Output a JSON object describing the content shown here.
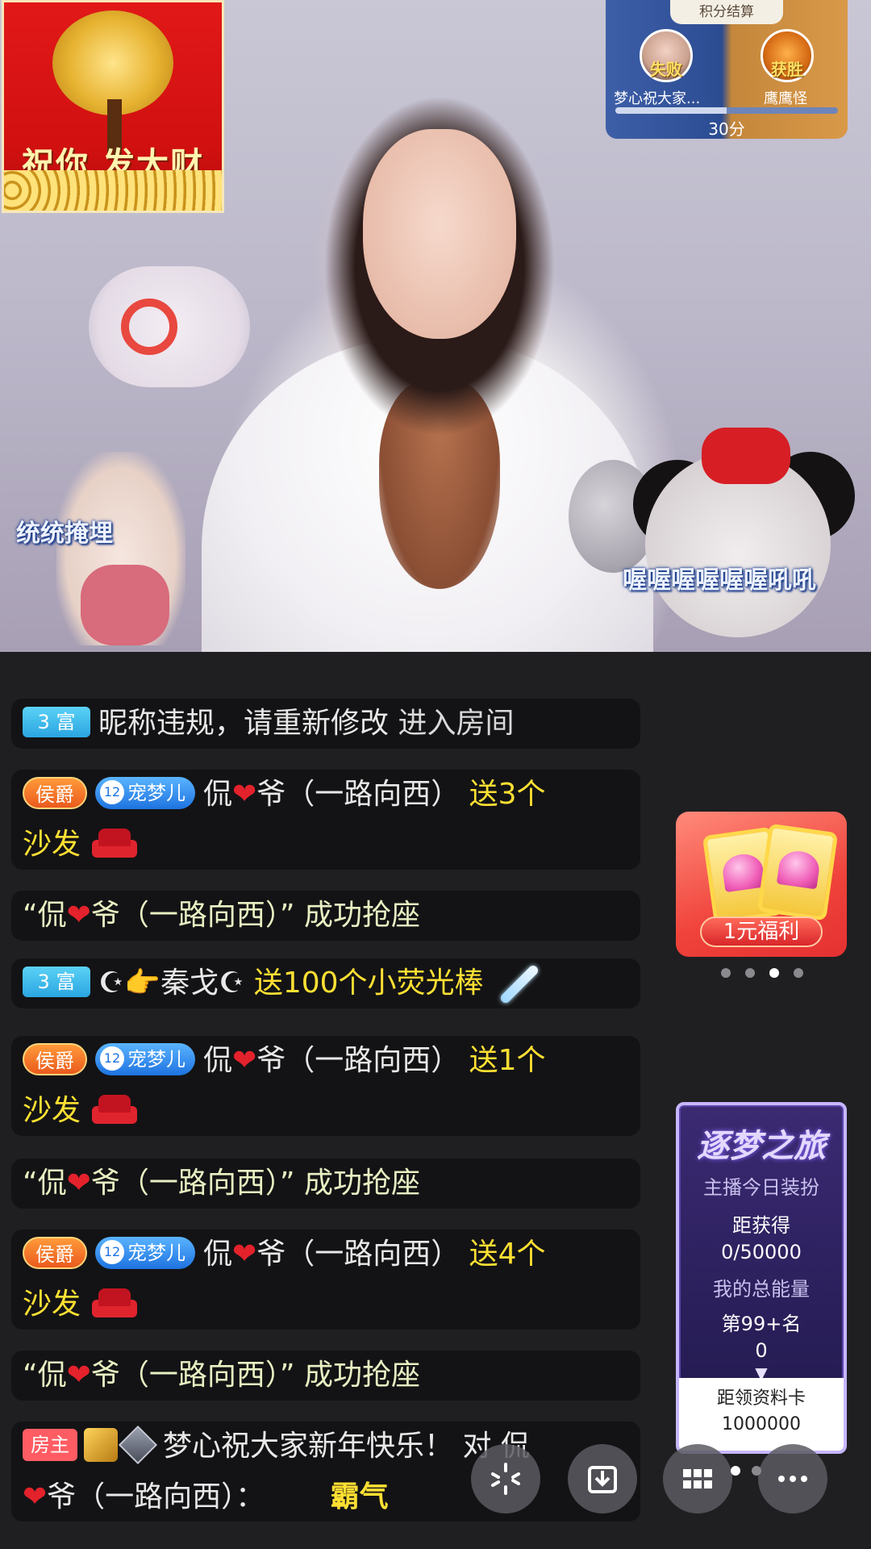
{
  "video": {
    "fortune_sticker": {
      "text": "祝你 发大财"
    },
    "pk_panel": {
      "title": "积分结算",
      "left_badge": "失败",
      "left_name": "梦心祝大家...",
      "right_badge": "获胜",
      "right_name": "鹰鹰怪",
      "score": "30分",
      "progress": 0.5
    },
    "floating_texts": {
      "left": "统统掩埋",
      "right": "喔喔喔喔喔喔吼吼"
    }
  },
  "chat": {
    "messages": [
      {
        "badge": "3 富",
        "name": "昵称违规，请重新修改",
        "action": "进入房间"
      },
      {
        "badge": "侯爵",
        "fan_level": "12",
        "fan_club": "宠梦儿",
        "user_pre": "侃",
        "user_post": "爷（一路向西）",
        "gift": "送3个",
        "gift_line2": "沙发"
      },
      {
        "text_pre": "“侃",
        "text_post": "爷（一路向西）”",
        "action": "成功抢座"
      },
      {
        "badge": "3 富",
        "user": "☪👉秦戈☪",
        "gift": "送100个小荧光棒"
      },
      {
        "badge": "侯爵",
        "fan_level": "12",
        "fan_club": "宠梦儿",
        "user_pre": "侃",
        "user_post": "爷（一路向西）",
        "gift": "送1个",
        "gift_line2": "沙发"
      },
      {
        "text_pre": "“侃",
        "text_post": "爷（一路向西）”",
        "action": "成功抢座"
      },
      {
        "badge": "侯爵",
        "fan_level": "12",
        "fan_club": "宠梦儿",
        "user_pre": "侃",
        "user_post": "爷（一路向西）",
        "gift": "送4个",
        "gift_line2": "沙发"
      },
      {
        "text_pre": "“侃",
        "text_post": "爷（一路向西）”",
        "action": "成功抢座"
      },
      {
        "badge": "房主",
        "line1": "梦心祝大家新年快乐！ 对 侃",
        "line2_post": "爷（一路向西）：",
        "emote": "霸气"
      }
    ]
  },
  "promo": {
    "label": "1元福利",
    "pages": 4,
    "active_page": 3
  },
  "journey": {
    "title": "逐梦之旅",
    "subtitle": "主播今日装扮",
    "distance_label": "距获得",
    "distance_value": "0/50000",
    "energy_label": "我的总能量",
    "rank": "第99+名",
    "energy_value": "0",
    "card_label": "距领资料卡",
    "card_value": "1000000"
  },
  "toolbar": {
    "buttons": [
      "sparkle-icon",
      "download-icon",
      "grid-icon",
      "more-icon"
    ],
    "pages": 2,
    "active_page": 1
  },
  "colors": {
    "gift_yellow": "#ffe033",
    "rich_badge": "#2aa5e1",
    "marquis_badge": "#ea5a1d",
    "host_badge": "#ff5c63",
    "heart": "#e3222c"
  }
}
